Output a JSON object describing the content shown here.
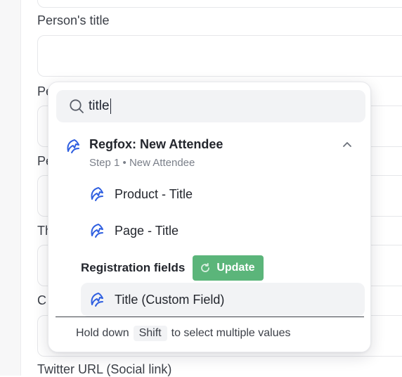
{
  "form": {
    "persons_title_label": "Person's title",
    "label_p1": "Pe",
    "label_p2": "Pe",
    "label_t": "Th",
    "label_c": "C",
    "twitter_label": "Twitter URL (Social link)"
  },
  "dropdown": {
    "search": {
      "value": "title"
    },
    "group": {
      "title": "Regfox: New Attendee",
      "subtitle": "Step 1 • New Attendee",
      "items": [
        {
          "label": "Product - Title"
        },
        {
          "label": "Page - Title"
        }
      ]
    },
    "registration_section": {
      "label": "Registration fields",
      "update_label": "Update",
      "items": [
        {
          "label": "Title (Custom Field)"
        }
      ]
    },
    "footer": {
      "prefix": "Hold down",
      "key": "Shift",
      "suffix": "to select multiple values"
    }
  },
  "colors": {
    "accent_blue": "#2f5fe0",
    "update_green": "#5bb57a"
  }
}
